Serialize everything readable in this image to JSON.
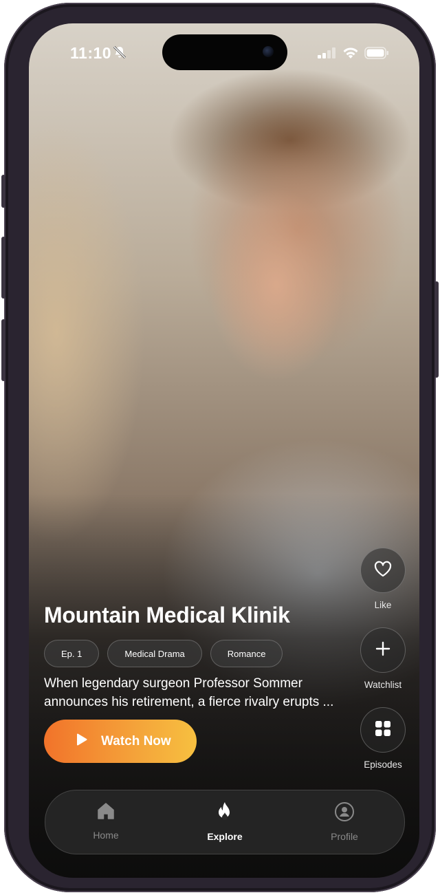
{
  "status_bar": {
    "time": "11:10"
  },
  "show": {
    "title": "Mountain Medical Klinik",
    "tags": [
      "Ep. 1",
      "Medical Drama",
      "Romance"
    ],
    "description": "When legendary surgeon Professor Sommer announces his retirement, a fierce rivalry erupts ...",
    "cta_label": "Watch Now"
  },
  "actions": [
    {
      "label": "Like",
      "icon": "heart-icon"
    },
    {
      "label": "Watchlist",
      "icon": "plus-icon"
    },
    {
      "label": "Episodes",
      "icon": "grid-icon"
    }
  ],
  "tab_bar": {
    "items": [
      {
        "label": "Home",
        "icon": "home-icon",
        "active": false
      },
      {
        "label": "Explore",
        "icon": "flame-icon",
        "active": true
      },
      {
        "label": "Profile",
        "icon": "profile-icon",
        "active": false
      }
    ]
  },
  "colors": {
    "accent_start": "#f2732a",
    "accent_end": "#f7c040"
  }
}
